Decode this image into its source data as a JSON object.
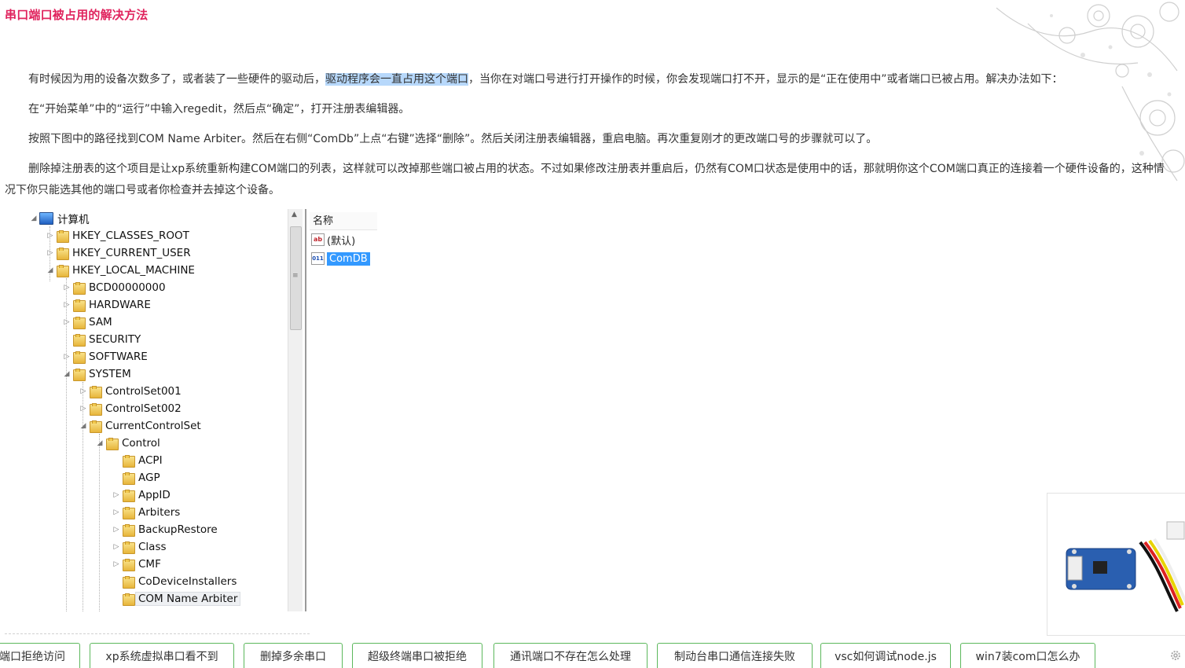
{
  "article": {
    "title": "串口端口被占用的解决方法",
    "p1_before": "有时候因为用的设备次数多了，或者装了一些硬件的驱动后，",
    "p1_highlight": "驱动程序会一直占用这个端口",
    "p1_after": "，当你在对端口号进行打开操作的时候，你会发现端口打不开，显示的是“正在使用中”或者端口已被占用。解决办法如下：",
    "p2": "在“开始菜单”中的“运行”中输入regedit，然后点“确定”，打开注册表编辑器。",
    "p3": "按照下图中的路径找到COM Name Arbiter。然后在右侧“ComDb”上点“右键”选择“删除”。然后关闭注册表编辑器，重启电脑。再次重复刚才的更改端口号的步骤就可以了。",
    "p4": "删除掉注册表的这个项目是让xp系统重新构建COM端口的列表，这样就可以改掉那些端口被占用的状态。不过如果修改注册表并重启后，仍然有COM口状态是使用中的话，那就明你这个COM端口真正的连接着一个硬件设备的，这种情况下你只能选其他的端口号或者你检查并去掉这个设备。"
  },
  "registry": {
    "tree": [
      {
        "label": "计算机",
        "expander": "◢",
        "icon": "computer-icon"
      },
      {
        "label": "HKEY_CLASSES_ROOT",
        "expander": "▷"
      },
      {
        "label": "HKEY_CURRENT_USER",
        "expander": "▷"
      },
      {
        "label": "HKEY_LOCAL_MACHINE",
        "expander": "◢"
      },
      {
        "label": "BCD00000000",
        "expander": "▷"
      },
      {
        "label": "HARDWARE",
        "expander": "▷"
      },
      {
        "label": "SAM",
        "expander": "▷"
      },
      {
        "label": "SECURITY",
        "expander": ""
      },
      {
        "label": "SOFTWARE",
        "expander": "▷"
      },
      {
        "label": "SYSTEM",
        "expander": "◢"
      },
      {
        "label": "ControlSet001",
        "expander": "▷"
      },
      {
        "label": "ControlSet002",
        "expander": "▷"
      },
      {
        "label": "CurrentControlSet",
        "expander": "◢"
      },
      {
        "label": "Control",
        "expander": "◢"
      },
      {
        "label": "ACPI",
        "expander": ""
      },
      {
        "label": "AGP",
        "expander": ""
      },
      {
        "label": "AppID",
        "expander": "▷"
      },
      {
        "label": "Arbiters",
        "expander": "▷"
      },
      {
        "label": "BackupRestore",
        "expander": "▷"
      },
      {
        "label": "Class",
        "expander": "▷"
      },
      {
        "label": "CMF",
        "expander": "▷"
      },
      {
        "label": "CoDeviceInstallers",
        "expander": ""
      },
      {
        "label": "COM Name Arbiter",
        "expander": ""
      }
    ],
    "column_header": "名称",
    "values": [
      {
        "icon_text": "ab",
        "label": "(默认)"
      },
      {
        "icon_text": "011",
        "label": "ComDB"
      }
    ],
    "scroll_up": "▲",
    "scroll_grip": "≡"
  },
  "related_tags": [
    "端口拒绝访问",
    "xp系统虚拟串口看不到",
    "删掉多余串口",
    "超级终端串口被拒绝",
    "通讯端口不存在怎么处理",
    "制动台串口通信连接失败",
    "vsc如何调试node.js",
    "win7装com口怎么办"
  ],
  "colors": {
    "title": "#e0245e",
    "highlight": "#b7d8fb",
    "tag_border": "#5cb85c",
    "selection": "#3399ff"
  }
}
